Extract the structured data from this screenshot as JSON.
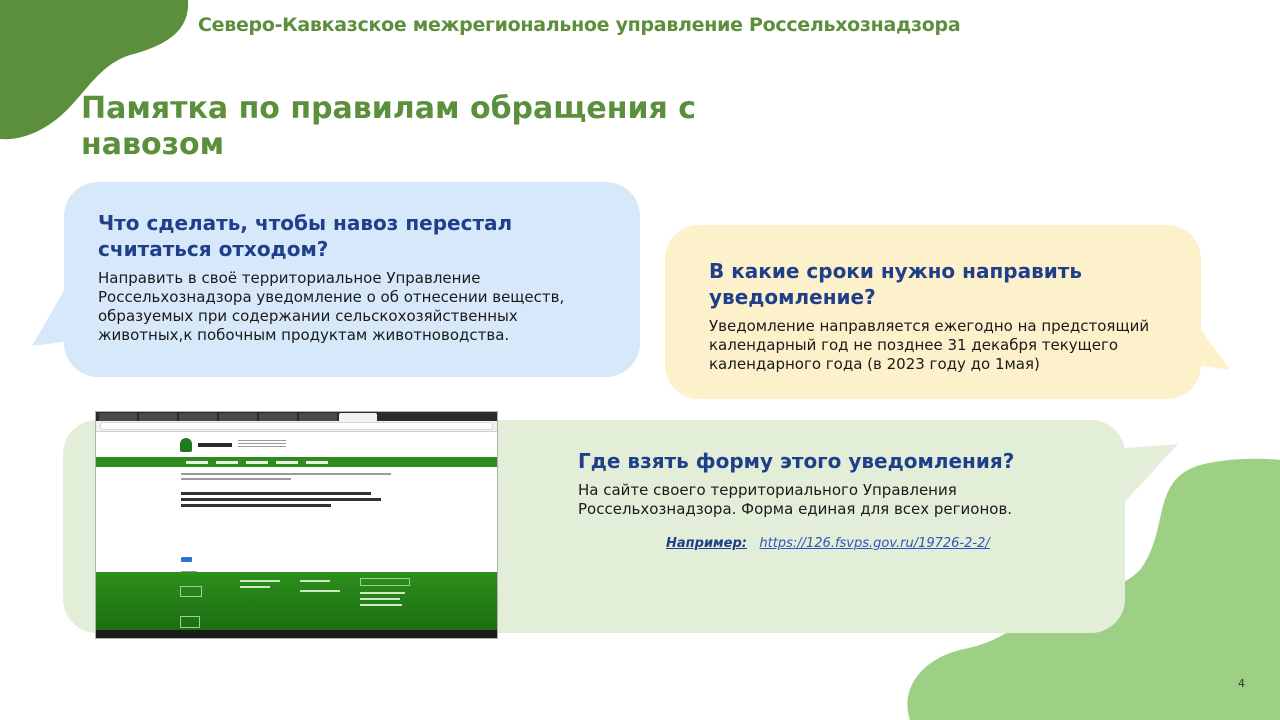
{
  "header": {
    "org_name": "Северо-Кавказское межрегиональное управление Россельхознадзора",
    "title": "Памятка по правилам обращения с навозом"
  },
  "faq": [
    {
      "question": "Что сделать, чтобы навоз перестал считаться отходом?",
      "answer": "Направить в своё территориальное Управление Россельхознадзора уведомление о об отнесении веществ, образуемых при содержании сельскохозяйственных животных,к побочным продуктам животноводства."
    },
    {
      "question": "В какие сроки нужно направить уведомление?",
      "answer": "Уведомление направляется ежегодно на предстоящий календарный год не позднее 31 декабря текущего календарного года (в 2023 году до 1мая)"
    },
    {
      "question": "Где взять форму этого уведомления?",
      "answer": "На сайте своего территориального Управления Россельхознадзора. Форма единая для всех регионов.",
      "example_label": "Например:",
      "example_url": "https://126.fsvps.gov.ru/19726-2-2/"
    }
  ],
  "page_number": "4",
  "colors": {
    "accent_green": "#5b8f3c",
    "question_blue": "#1f3f8a",
    "bubble_blue": "#d7e8fb",
    "bubble_yellow": "#fdf1cc",
    "bubble_green": "#e3eed9"
  }
}
